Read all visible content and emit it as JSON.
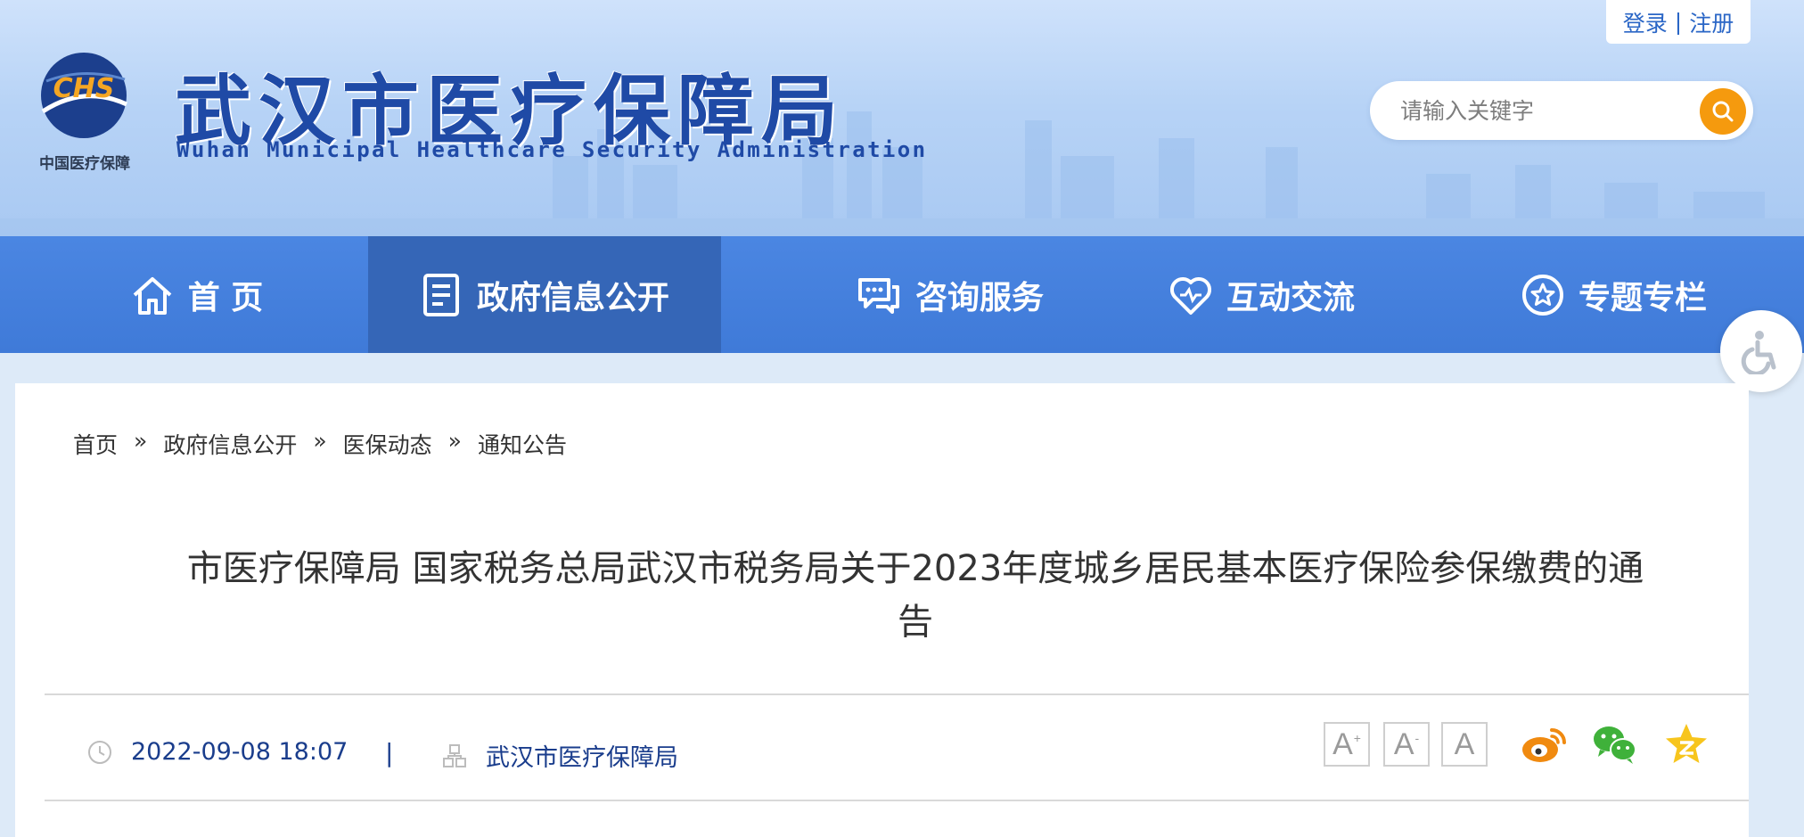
{
  "header": {
    "logo_caption": "中国医疗保障",
    "logo_mark": "CHS",
    "site_title": "武汉市医疗保障局",
    "site_subtitle": "Wuhan Municipal Healthcare Security Administration",
    "auth": {
      "login": "登录",
      "separator": "|",
      "register": "注册"
    },
    "search": {
      "placeholder": "请输入关键字"
    }
  },
  "nav": {
    "items": [
      {
        "label": "首 页",
        "icon": "home-icon"
      },
      {
        "label": "政府信息公开",
        "icon": "document-icon",
        "active": true
      },
      {
        "label": "咨询服务",
        "icon": "chat-icon"
      },
      {
        "label": "互动交流",
        "icon": "heart-icon"
      },
      {
        "label": "专题专栏",
        "icon": "star-icon"
      }
    ]
  },
  "breadcrumb": {
    "items": [
      "首页",
      "政府信息公开",
      "医保动态",
      "通知公告"
    ],
    "separator": "»"
  },
  "article": {
    "title": "市医疗保障局 国家税务总局武汉市税务局关于2023年度城乡居民基本医疗保险参保缴费的通告",
    "date": "2022-09-08 18:07",
    "meta_separator": "|",
    "source": "武汉市医疗保障局"
  },
  "font_size": {
    "increase": "A",
    "decrease": "A",
    "reset": "A",
    "plus": "+",
    "minus": "-"
  },
  "share": [
    "weibo-icon",
    "wechat-icon",
    "qzone-icon"
  ],
  "colors": {
    "nav": "#3f7ad8",
    "nav_active": "#3566b7",
    "accent": "#f59a0e",
    "title_blue": "#1f4aa6"
  }
}
